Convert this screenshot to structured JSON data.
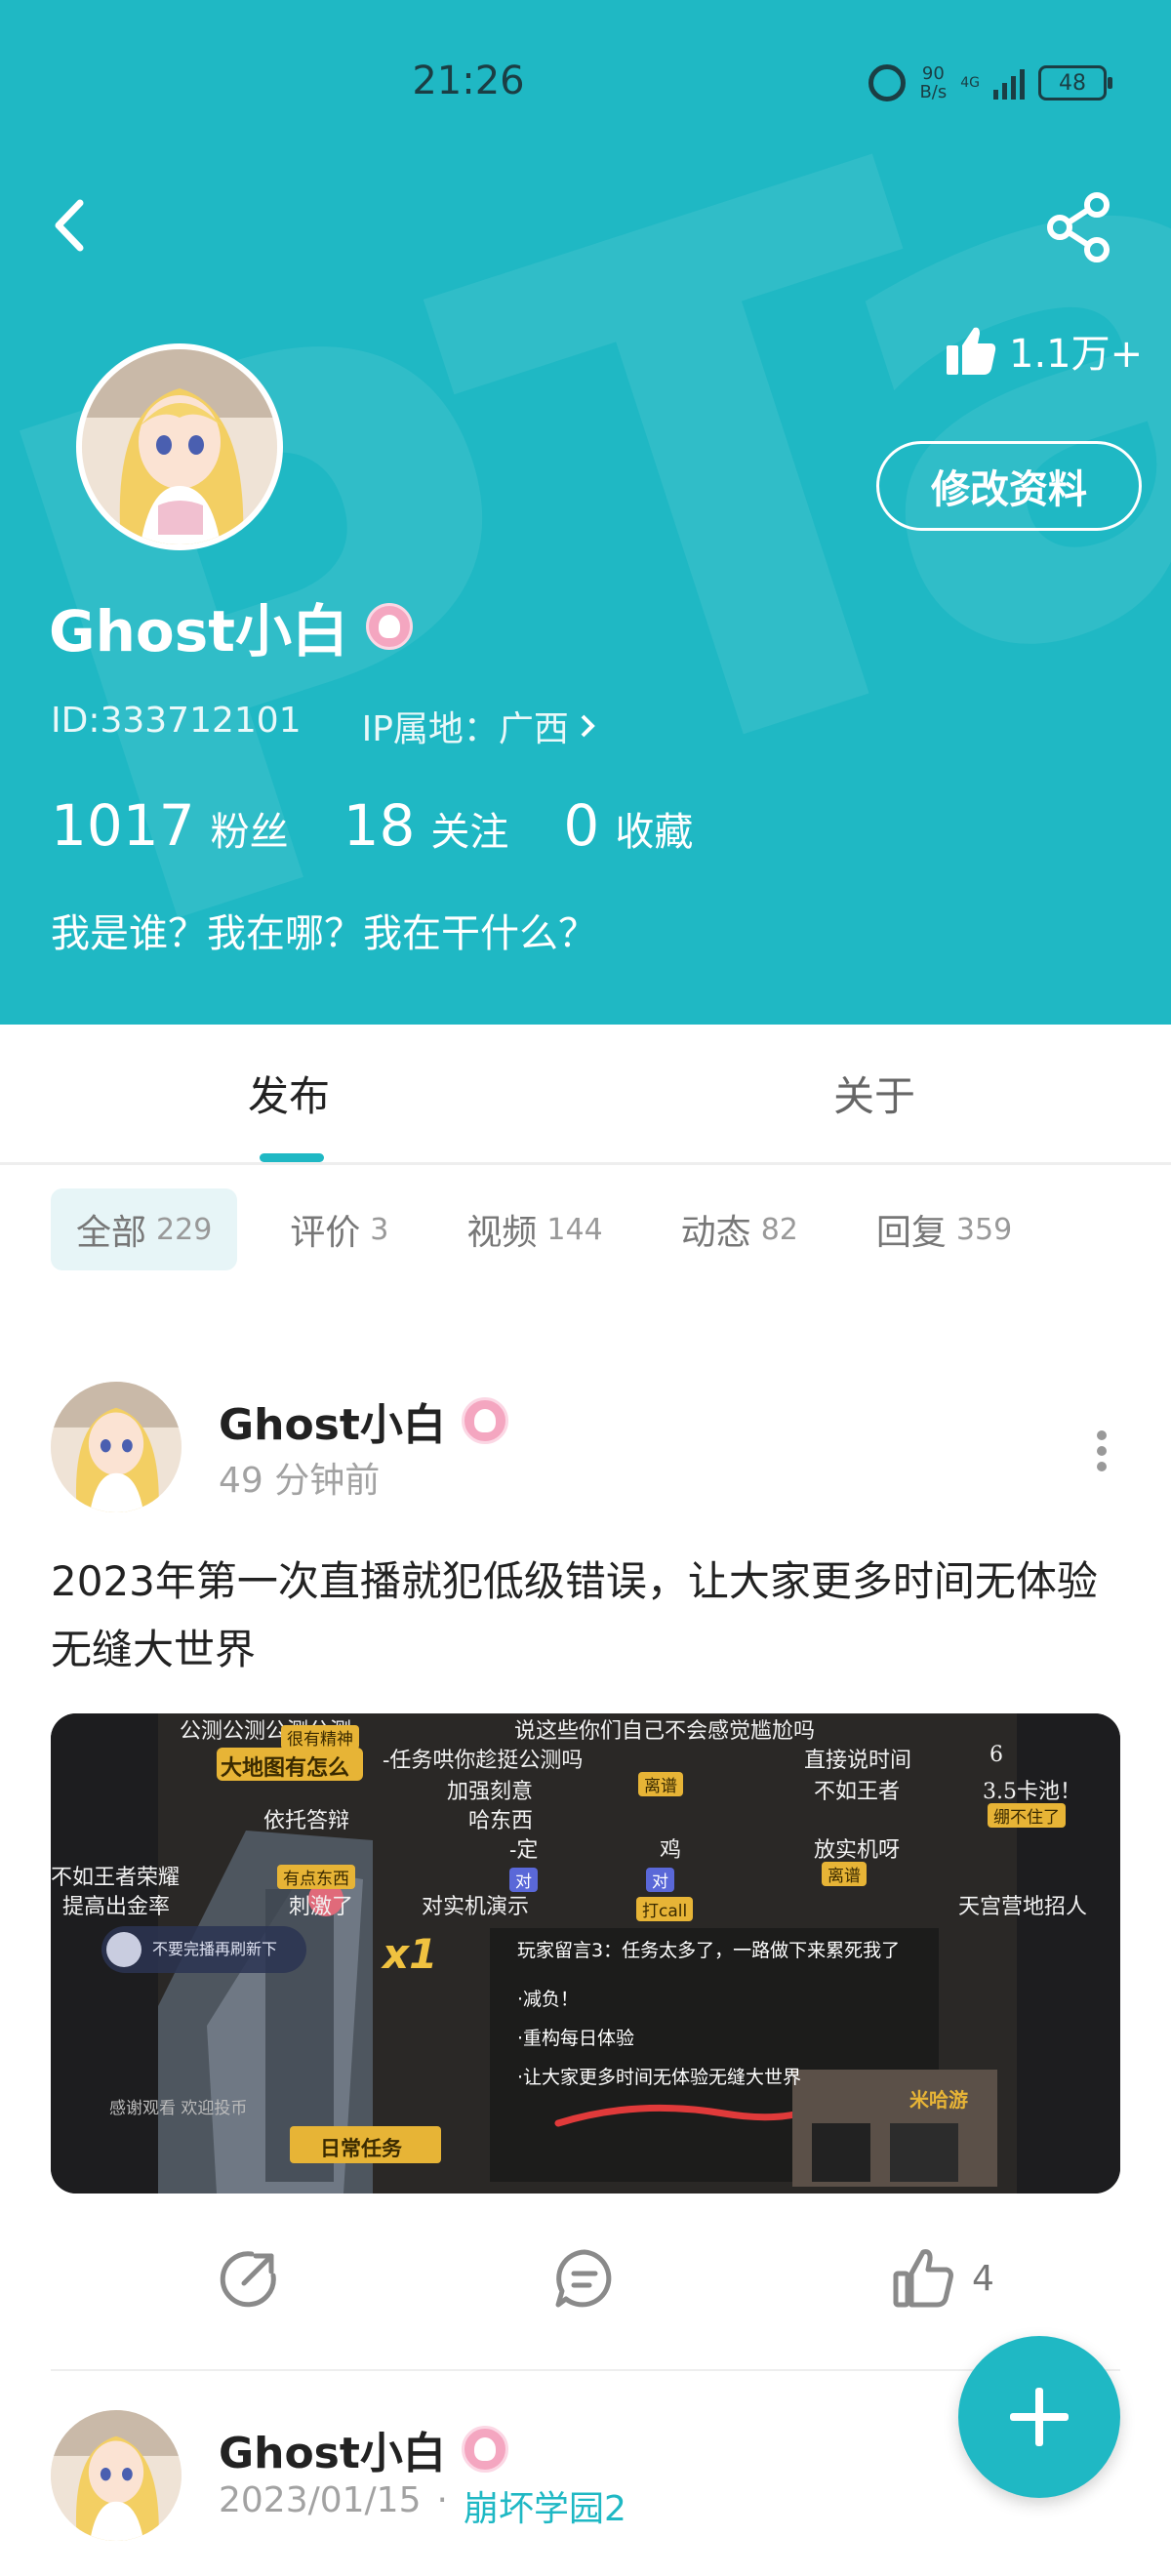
{
  "status_bar": {
    "time": "21:26",
    "net_speed_value": "90",
    "net_speed_unit": "B/s",
    "network": "4G",
    "battery": "48"
  },
  "header": {
    "likes": "1.1万+",
    "edit_label": "修改资料",
    "name": "Ghost小白",
    "id_text": "ID:333712101",
    "ip_text": "IP属地：广西",
    "stats": [
      {
        "num": "1017",
        "label": "粉丝"
      },
      {
        "num": "18",
        "label": "关注"
      },
      {
        "num": "0",
        "label": "收藏"
      }
    ],
    "bio": "我是谁？我在哪？我在干什么？"
  },
  "tabs": {
    "active": "发布",
    "inactive": "关于"
  },
  "filters": [
    {
      "label": "全部",
      "count": "229"
    },
    {
      "label": "评价",
      "count": "3"
    },
    {
      "label": "视频",
      "count": "144"
    },
    {
      "label": "动态",
      "count": "82"
    },
    {
      "label": "回复",
      "count": "359"
    }
  ],
  "posts": [
    {
      "author": "Ghost小白",
      "time": "49 分钟前",
      "text": "2023年第一次直播就犯低级错误，让大家更多时间无体验无缝大世界",
      "likes": "4",
      "media": {
        "danmaku": [
          "公测公测公测公测",
          "说这些你们自己不会感觉尴尬吗",
          "-任务哄你趁挺公测吗",
          "加强刻意",
          "直接说时间",
          "依托答辩",
          "哈东西",
          "不如王者",
          "3.5卡池！",
          "6",
          "-定",
          "鸡",
          "放实机呀",
          "不如王者荣耀",
          "提高出金率",
          "刺激了",
          "对实机演示",
          "天宫营地招人"
        ],
        "badges": [
          "很有精神",
          "离谱",
          "有点东西",
          "离谱",
          "打call",
          "绷不住了",
          "对",
          "对"
        ],
        "quest_title": "玩家留言3：任务太多了，一路做下来累死我了",
        "quest_items": [
          "·减负！",
          "·重构每日体验",
          "·让大家更多时间无体验无缝大世界"
        ],
        "task_label": "日常任务",
        "multiplier": "x1",
        "headline": "大地图有怎么",
        "small_text": "不要完播再刷新下",
        "bottom_text": "感谢观看 欢迎投币",
        "stream_label": "米哈游"
      }
    },
    {
      "author": "Ghost小白",
      "time": "2023/01/15",
      "game": "崩坏学园2"
    }
  ]
}
